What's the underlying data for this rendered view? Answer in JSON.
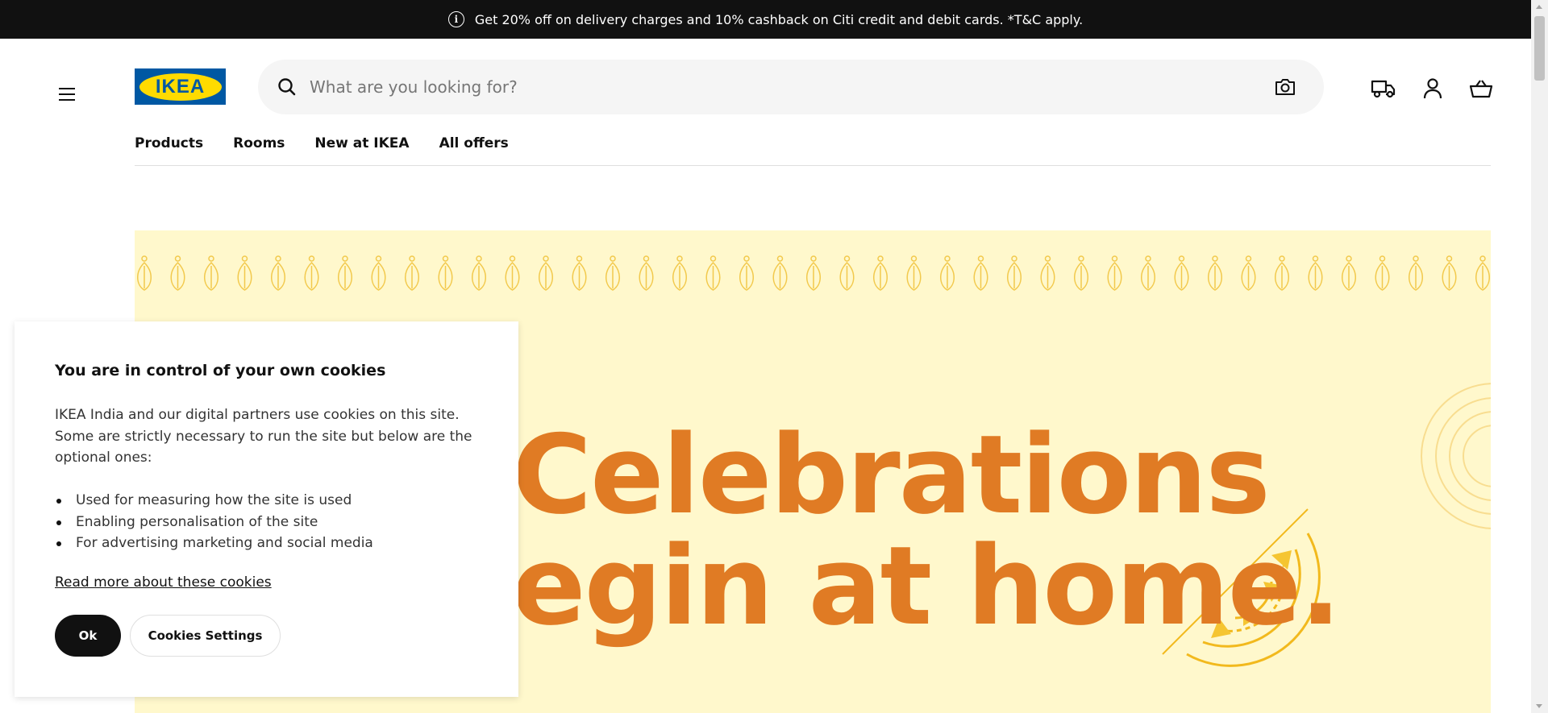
{
  "promo": {
    "icon": "info-icon",
    "text": "Get 20% off on delivery charges and 10% cashback on Citi credit and debit cards. *T&C apply."
  },
  "header": {
    "logo_text": "IKEA",
    "search_placeholder": "What are you looking for?",
    "icons": [
      "menu-icon",
      "search-icon",
      "camera-icon",
      "delivery-truck-icon",
      "user-icon",
      "shopping-bag-icon"
    ]
  },
  "nav": {
    "items": [
      {
        "label": "Products"
      },
      {
        "label": "Rooms"
      },
      {
        "label": "New at IKEA"
      },
      {
        "label": "All offers"
      }
    ]
  },
  "hero": {
    "line1": "Celebrations",
    "line2": "egin at home.",
    "background_color": "#fff8cc",
    "text_color": "#e07b24"
  },
  "cookie_dialog": {
    "title": "You are in control of your own cookies",
    "description": "IKEA India and our digital partners use cookies on this site. Some are strictly necessary to run the site but below are the optional ones:",
    "bullets": [
      "Used for measuring how the site is used",
      "Enabling personalisation of the site",
      "For advertising marketing and social media"
    ],
    "read_more": "Read more about these cookies",
    "ok_label": "Ok",
    "settings_label": "Cookies Settings"
  },
  "colors": {
    "brand_blue": "#0058a3",
    "brand_yellow": "#ffdb00",
    "promo_bg": "#111111"
  }
}
